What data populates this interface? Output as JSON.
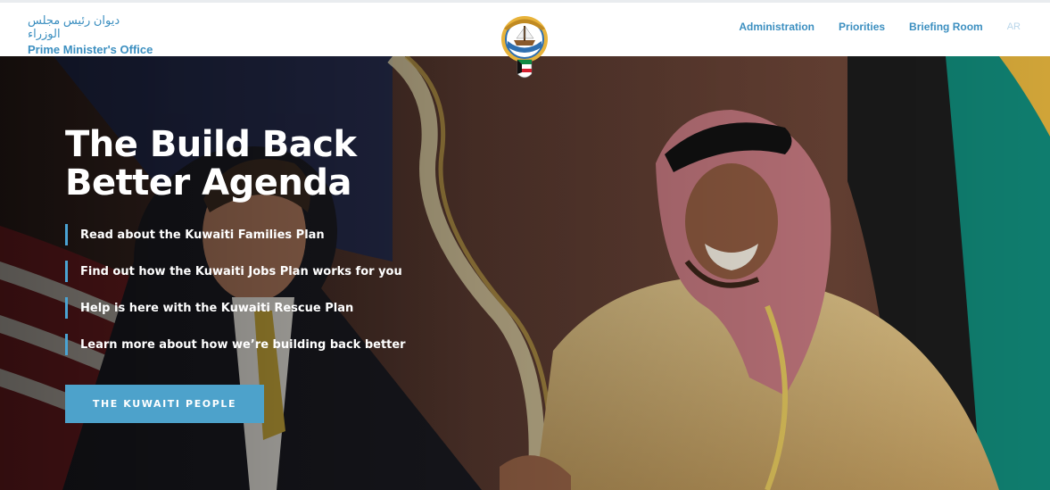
{
  "header": {
    "brand_ar": "ديوان رئيس مجلس الوزراء",
    "brand_en": "Prime Minister's Office",
    "emblem": "state-emblem",
    "nav": [
      {
        "label": "Administration"
      },
      {
        "label": "Priorities"
      },
      {
        "label": "Briefing Room"
      },
      {
        "label": "AR"
      }
    ]
  },
  "hero": {
    "title": "The Build Back Better Agenda",
    "links": [
      {
        "label": "Read about the Kuwaiti Families Plan"
      },
      {
        "label": "Find out how the Kuwaiti Jobs Plan works for you"
      },
      {
        "label": "Help is here with the Kuwaiti Rescue Plan"
      },
      {
        "label": "Learn more about how we’re building back better"
      }
    ],
    "cta_label": "THE KUWAITI PEOPLE"
  },
  "colors": {
    "accent": "#3c8fc0",
    "button": "#4da2cb",
    "link_bar": "#4aa3d3"
  }
}
